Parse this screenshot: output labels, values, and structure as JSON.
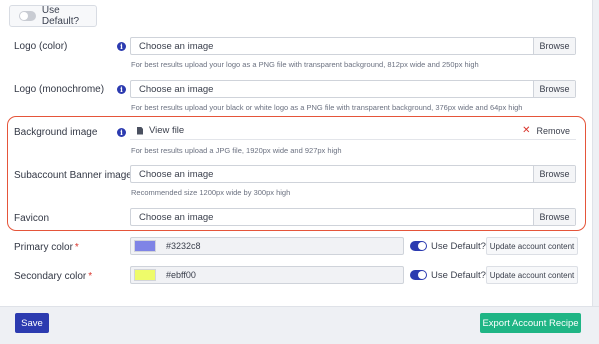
{
  "top_toggle": {
    "label": "Use Default?"
  },
  "rows": {
    "logo_color": {
      "label": "Logo (color)",
      "placeholder": "Choose an image",
      "browse": "Browse",
      "help": "For best results upload your logo as a PNG file with transparent background, 812px wide and 250px high"
    },
    "logo_mono": {
      "label": "Logo (monochrome)",
      "placeholder": "Choose an image",
      "browse": "Browse",
      "help": "For best results upload your black or white logo as a PNG file with transparent background, 376px wide and 64px high"
    },
    "background": {
      "label": "Background image",
      "view_file": "View file",
      "remove": "Remove",
      "help": "For best results upload a JPG file, 1920px wide and 927px high"
    },
    "subaccount_banner": {
      "label": "Subaccount Banner image",
      "placeholder": "Choose an image",
      "browse": "Browse",
      "help": "Recommended size 1200px wide by 300px high"
    },
    "favicon": {
      "label": "Favicon",
      "placeholder": "Choose an image",
      "browse": "Browse"
    },
    "primary_color": {
      "label": "Primary color",
      "required_mark": "*",
      "hex": "#3232c8",
      "swatch_color": "#7f84e6",
      "use_default": "Use Default?",
      "use_default_on": true,
      "update": "Update account content"
    },
    "secondary_color": {
      "label": "Secondary color",
      "required_mark": "*",
      "hex": "#ebff00",
      "swatch_color": "#eefb6a",
      "use_default": "Use Default?",
      "use_default_on": true,
      "update": "Update account content"
    }
  },
  "footer": {
    "save": "Save",
    "export": "Export Account Recipe"
  },
  "colors": {
    "primary_button": "#2c3bb0",
    "export_button": "#1fb585",
    "highlight_border": "#e5553a",
    "remove_x": "#d9342b"
  }
}
